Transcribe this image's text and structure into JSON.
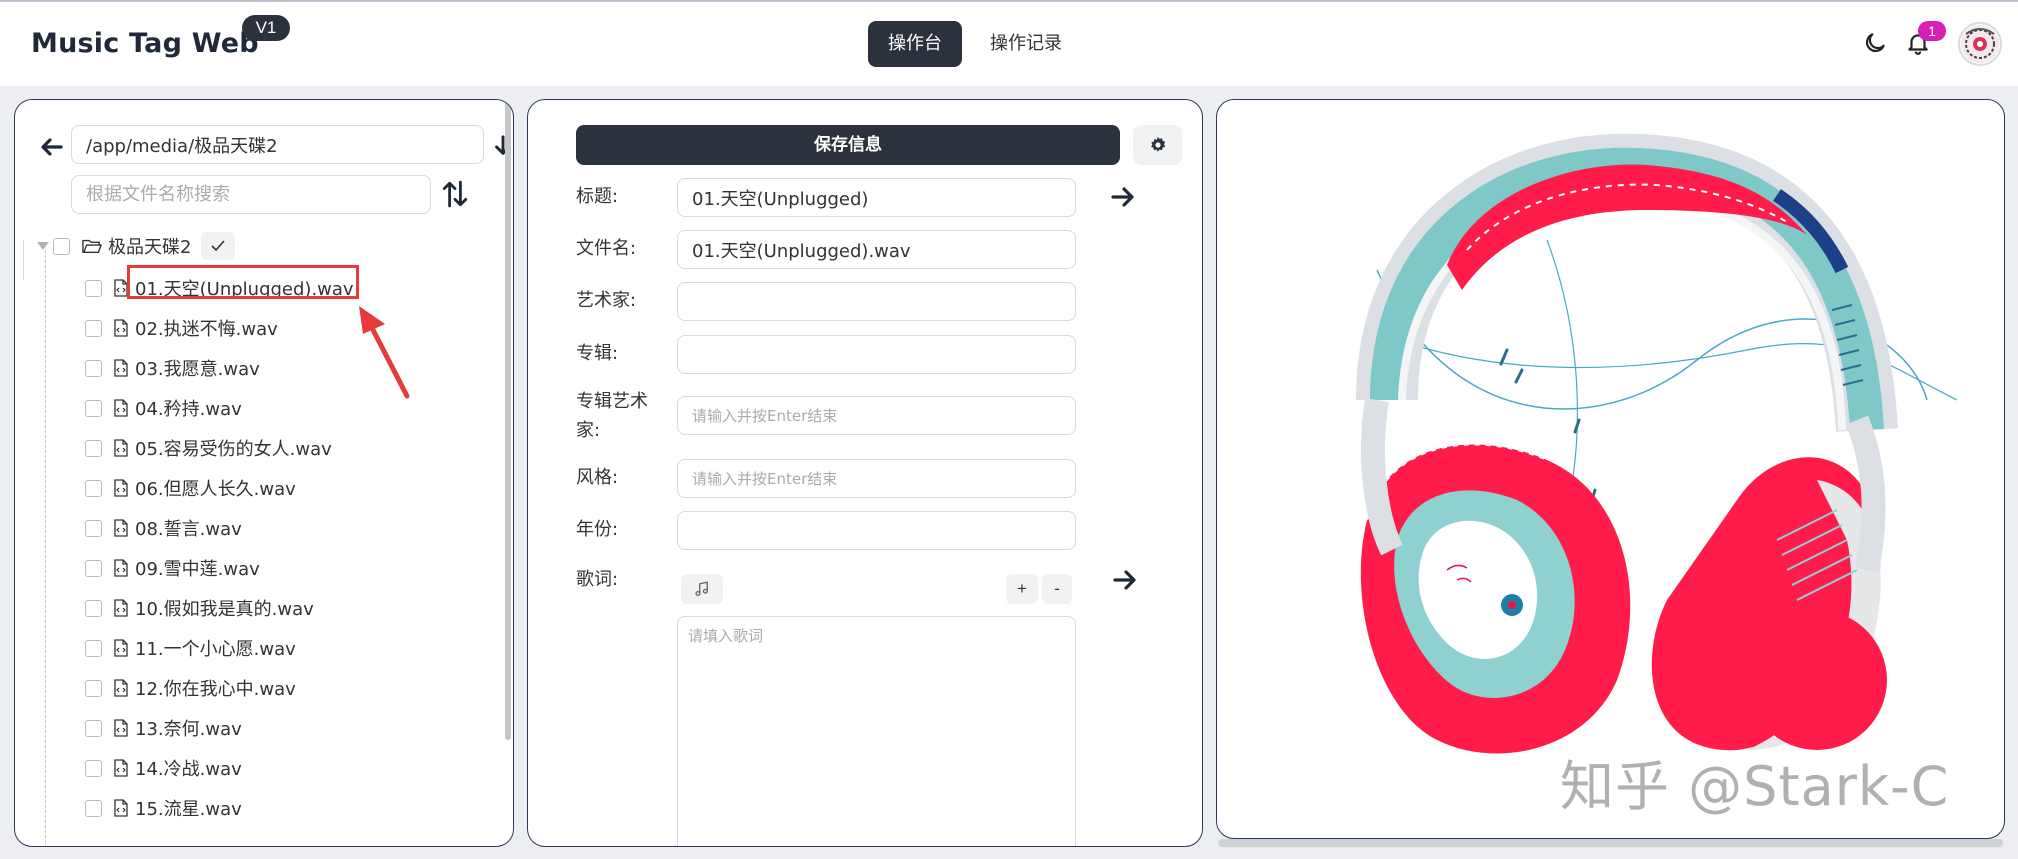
{
  "header": {
    "brand": "Music Tag Web",
    "version": "V1",
    "tabs": [
      {
        "label": "操作台",
        "active": true
      },
      {
        "label": "操作记录",
        "active": false
      }
    ],
    "notification_count": "1",
    "icons": [
      "moon-icon",
      "bell-icon",
      "avatar"
    ]
  },
  "left": {
    "path": "/app/media/极品天碟2",
    "search_placeholder": "根据文件名称搜索",
    "root_folder": "极品天碟2",
    "files": [
      "01.天空(Unplugged).wav",
      "02.执迷不悔.wav",
      "03.我愿意.wav",
      "04.矜持.wav",
      "05.容易受伤的女人.wav",
      "06.但愿人长久.wav",
      "08.誓言.wav",
      "09.雪中莲.wav",
      "10.假如我是真的.wav",
      "11.一个小心愿.wav",
      "12.你在我心中.wav",
      "13.奈何.wav",
      "14.冷战.wav",
      "15.流星.wav"
    ]
  },
  "middle": {
    "save_label": "保存信息",
    "fields": {
      "title_label": "标题:",
      "title_value": "01.天空(Unplugged)",
      "filename_label": "文件名:",
      "filename_value": "01.天空(Unplugged).wav",
      "artist_label": "艺术家:",
      "album_label": "专辑:",
      "album_artist_label_1": "专辑艺术",
      "album_artist_label_2": "家:",
      "album_artist_placeholder": "请输入并按Enter结束",
      "genre_label": "风格:",
      "genre_placeholder": "请输入并按Enter结束",
      "year_label": "年份:",
      "lyrics_label": "歌词:",
      "lyrics_placeholder": "请填入歌词",
      "plus": "+",
      "minus": "-"
    }
  },
  "right": {
    "watermark": "知乎 @Stark-C"
  },
  "colors": {
    "dark": "#2b323d",
    "highlight": "#e53b3b",
    "badge": "#d61fb5",
    "headphone_red": "#ff1c4a",
    "headphone_teal": "#7fc8c8"
  }
}
